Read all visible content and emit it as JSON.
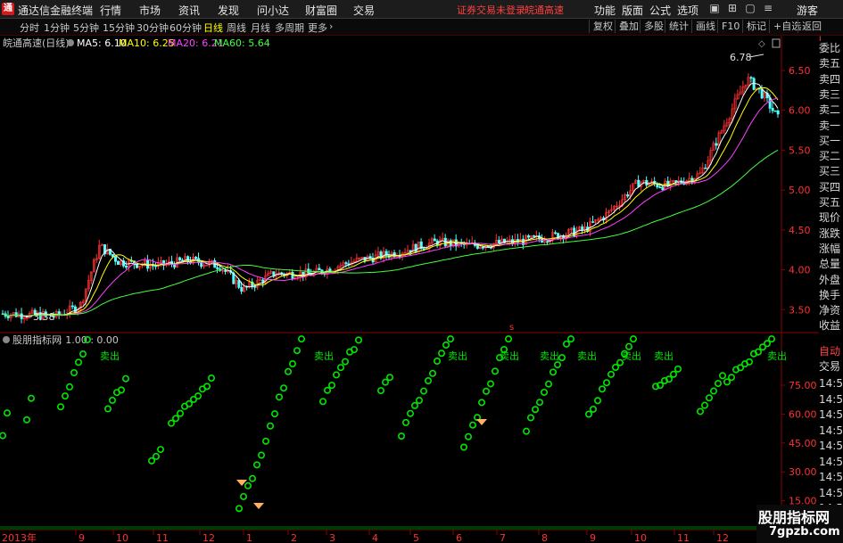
{
  "menubar": {
    "app_title": "通达信金融终端",
    "menus": [
      "行情",
      "市场",
      "资讯",
      "发现",
      "问小达",
      "财富圈",
      "交易"
    ],
    "warning": "证券交易未登录",
    "stock_name": "皖通高速",
    "right_menus": [
      "功能",
      "版面",
      "公式",
      "选项"
    ],
    "guest": "游客"
  },
  "periodbar": {
    "periods": [
      "分时",
      "1分钟",
      "5分钟",
      "15分钟",
      "30分钟",
      "60分钟",
      "日线",
      "周线",
      "月线",
      "多周期",
      "更多"
    ],
    "active": "日线",
    "tools": [
      "复权",
      "叠加",
      "多股",
      "统计",
      "画线",
      "F10",
      "标记",
      "+自选",
      "返回"
    ]
  },
  "main_panel": {
    "title": "皖通高速(日线)",
    "ma": [
      {
        "label": "MA5: 6.10",
        "color": "#ffffff"
      },
      {
        "label": "MA10: 6.25",
        "color": "#ffff00"
      },
      {
        "label": "MA20: 6.21",
        "color": "#ff40ff"
      },
      {
        "label": "MA60: 5.64",
        "color": "#40ff40"
      }
    ],
    "high_label": "6.78",
    "low_label": "3.38",
    "price_ticks": [
      "6.50",
      "6.00",
      "5.50",
      "5.00",
      "4.50",
      "4.00",
      "3.50"
    ],
    "s_mark": "s"
  },
  "sub_panel": {
    "title": "股朋指标网",
    "values": ": 1.00 : 0.00",
    "sell_label": "卖出",
    "ticks": [
      "75.00",
      "60.00",
      "45.00",
      "30.00",
      "15.00"
    ]
  },
  "right_panel": {
    "items": [
      "委比",
      "卖五",
      "卖四",
      "卖三",
      "卖二",
      "卖一",
      "买一",
      "买二",
      "买三",
      "买四",
      "买五",
      "现价",
      "涨跌",
      "涨幅",
      "总量",
      "外盘",
      "换手",
      "净资",
      "收益"
    ],
    "auto": "自动",
    "trade": "交易",
    "times": [
      "14:56",
      "14:56",
      "14:56",
      "14:56",
      "14:56",
      "14:56",
      "14:56",
      "14:56",
      "14:56",
      "14:56"
    ]
  },
  "time_axis": {
    "year": "2013年",
    "months": [
      "9",
      "10",
      "11",
      "12",
      "1",
      "2",
      "3",
      "4",
      "5",
      "6",
      "7",
      "8",
      "9",
      "10",
      "11",
      "12"
    ]
  },
  "watermark": {
    "line1": "股朋指标网",
    "line2": "7gpzb.com"
  },
  "colors": {
    "up": "#ff3232",
    "down": "#54ffff",
    "signal": "#00e600",
    "diamond": "#ffb060"
  }
}
